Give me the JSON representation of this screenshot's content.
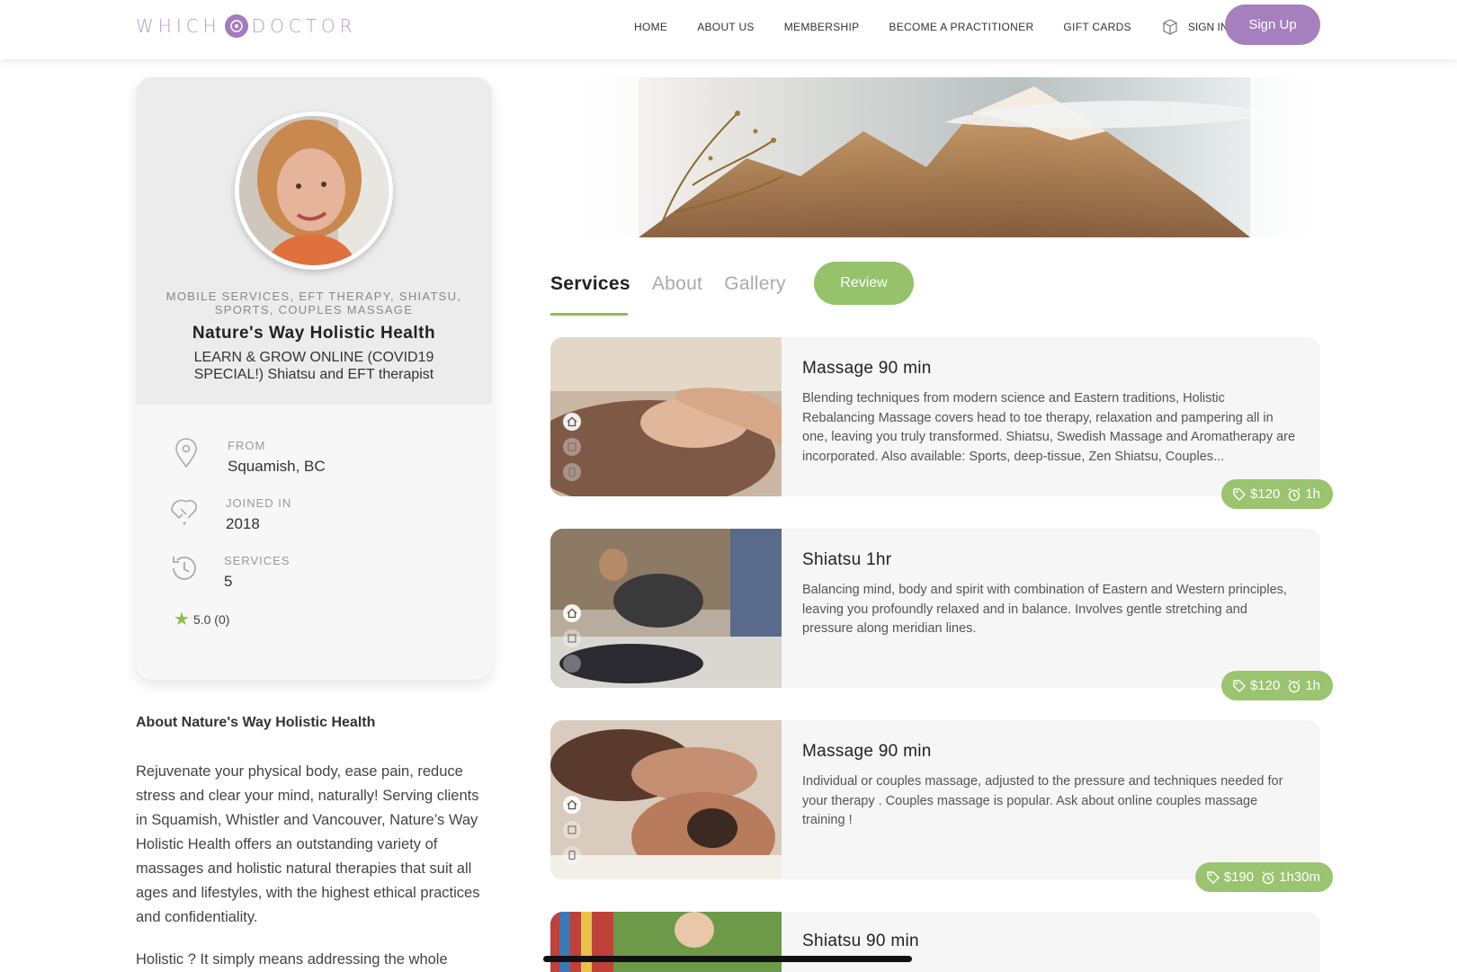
{
  "header": {
    "logo_left": "WHICH",
    "logo_right": "DOCTOR",
    "nav": [
      "HOME",
      "ABOUT US",
      "MEMBERSHIP",
      "BECOME A PRACTITIONER",
      "GIFT CARDS"
    ],
    "signin_label": "SIGN IN",
    "signup_label": "Sign Up",
    "brand_color": "#a67fbe"
  },
  "profile": {
    "tags": "MOBILE SERVICES, EFT THERAPY, SHIATSU, SPORTS, COUPLES MASSAGE",
    "name": "Nature's Way Holistic Health",
    "tagline": "LEARN & GROW ONLINE (COVID19 SPECIAL!) Shiatsu and EFT therapist",
    "from_label": "FROM",
    "from_value": "Squamish, BC",
    "joined_label": "JOINED IN",
    "joined_value": "2018",
    "services_label": "SERVICES",
    "services_value": "5",
    "rating": "5.0 (0)",
    "accent_color": "#8cc04a"
  },
  "about": {
    "title": "About Nature's Way Holistic Health",
    "p1": "Rejuvenate your physical body, ease pain, reduce stress and clear your mind, naturally! Serving clients in Squamish, Whistler and Vancouver, Nature’s Way Holistic Health offers an outstanding variety of massages and holistic natural therapies that suit all ages and lifestyles, with the highest ethical practices and confidentiality.",
    "p2": "Holistic ? It simply means addressing the whole"
  },
  "tabs": {
    "services": "Services",
    "about": "About",
    "gallery": "Gallery",
    "review": "Review"
  },
  "services": [
    {
      "title": "Massage 90 min",
      "desc": "Blending techniques from modern science and Eastern traditions, Holistic Rebalancing Massage covers head to toe therapy, relaxation and pampering all in one, leaving you truly transformed. Shiatsu, Swedish Massage and Aromatherapy are incorporated. Also available: Sports, deep-tissue, Zen Shiatsu, Couples...",
      "price": "$120",
      "duration": "1h"
    },
    {
      "title": "Shiatsu 1hr",
      "desc": "Balancing mind, body and spirit with combination of Eastern and Western principles, leaving you profoundly relaxed and in balance. Involves gentle stretching and pressure along meridian lines.",
      "price": "$120",
      "duration": "1h"
    },
    {
      "title": "Massage 90 min",
      "desc": "Individual or couples massage, adjusted to the pressure and techniques needed for your therapy . Couples massage is popular. Ask about online couples massage training !",
      "price": "$190",
      "duration": "1h30m"
    },
    {
      "title": "Shiatsu 90 min",
      "desc": "",
      "price": "",
      "duration": ""
    }
  ]
}
